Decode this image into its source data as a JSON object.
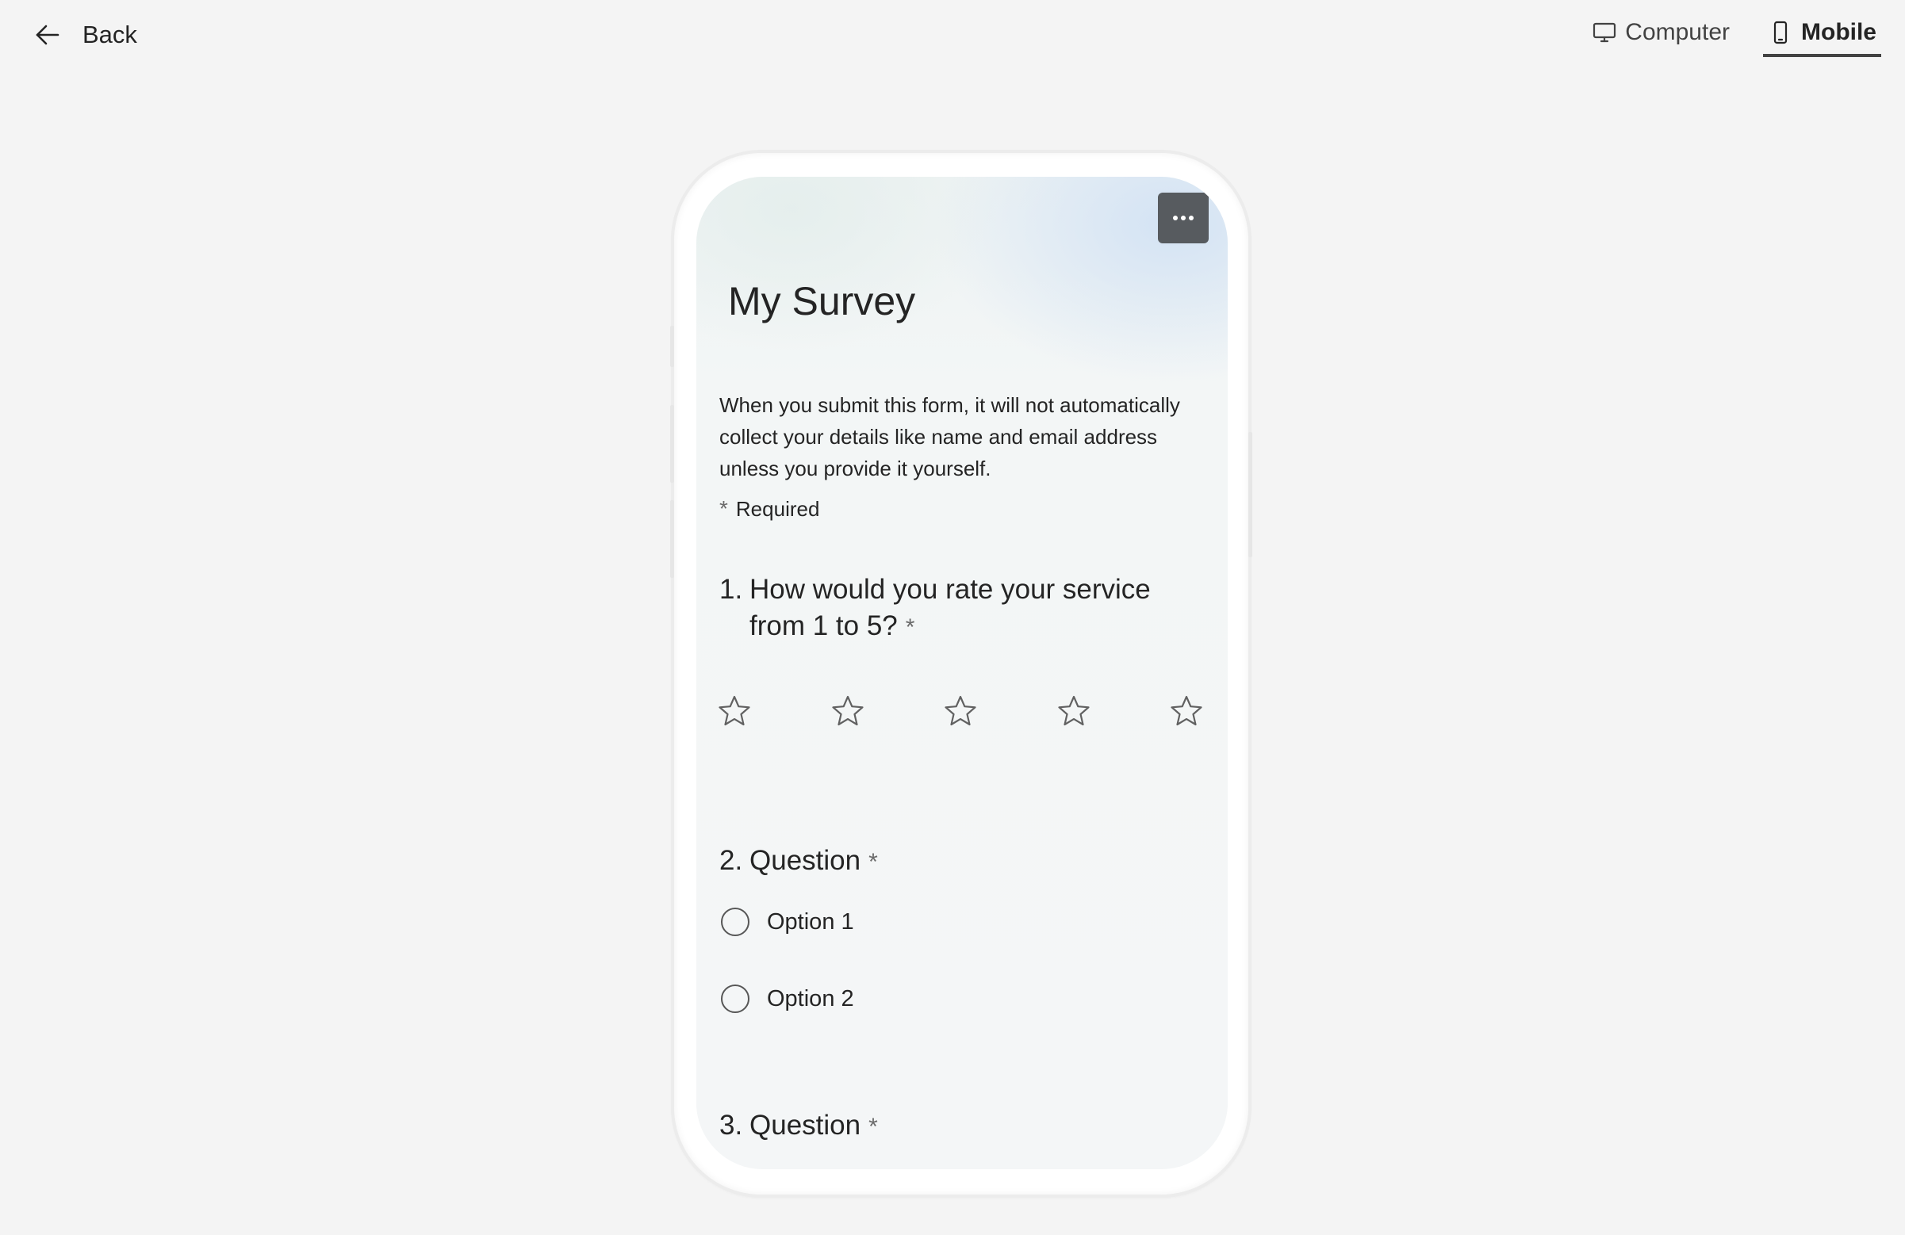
{
  "topbar": {
    "back_label": "Back",
    "views": [
      {
        "label": "Computer",
        "icon": "monitor-icon",
        "active": false
      },
      {
        "label": "Mobile",
        "icon": "mobile-icon",
        "active": true
      }
    ]
  },
  "form": {
    "title": "My Survey",
    "description": "When you submit this form, it will not automatically collect your details like name and email address unless you provide it yourself.",
    "required_marker": "*",
    "required_label": "Required",
    "more_options_icon": "more-horizontal-icon",
    "questions": [
      {
        "number": "1.",
        "text": "How would you rate your service from 1 to 5?",
        "required_marker": "*",
        "type": "rating",
        "max_rating": 5,
        "selected_rating": 0
      },
      {
        "number": "2.",
        "text": "Question",
        "required_marker": "*",
        "type": "choice",
        "options": [
          "Option 1",
          "Option 2"
        ]
      },
      {
        "number": "3.",
        "text": "Question",
        "required_marker": "*"
      }
    ]
  },
  "colors": {
    "page_background": "#f4f4f4",
    "text": "#242424",
    "more_button": "#575b5f",
    "active_tab_underline": "#424242"
  }
}
